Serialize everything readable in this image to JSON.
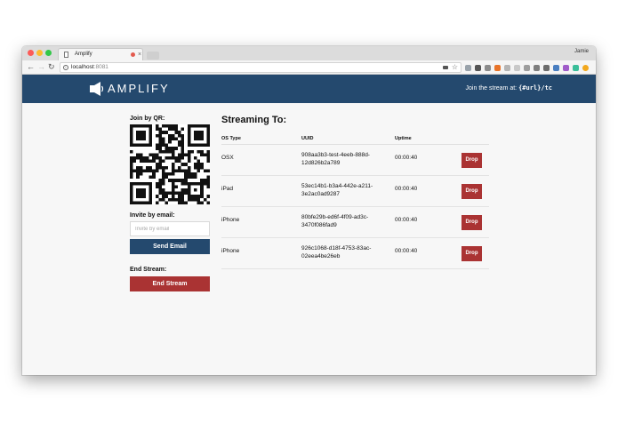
{
  "browser": {
    "tab_title": "Amplify",
    "user_name": "Jamie",
    "address_host": "localhost",
    "address_port": ":8081"
  },
  "header": {
    "logo_text": "AMPLIFY",
    "join_prefix": "Join the stream at: ",
    "join_url": "{#url}/tc"
  },
  "sidebar": {
    "qr_label": "Join by QR:",
    "email_label": "Invite by email:",
    "email_placeholder": "Invite by email",
    "send_button": "Send Email",
    "end_label": "End Stream:",
    "end_button": "End Stream"
  },
  "streams": {
    "title": "Streaming To:",
    "columns": [
      "OS Type",
      "UUID",
      "Uptime"
    ],
    "drop_label": "Drop",
    "rows": [
      {
        "os": "OSX",
        "uuid_line1": "908aa3b3-test-4eeb-888d-",
        "uuid_line2": "12d826b2a789",
        "uptime": "00:00:40"
      },
      {
        "os": "iPad",
        "uuid_line1": "53ec14b1-b3a4-442e-a211-",
        "uuid_line2": "3e2ac0ad9287",
        "uptime": "00:00:40"
      },
      {
        "os": "iPhone",
        "uuid_line1": "80bfe29b-ed6f-4f09-ad3c-",
        "uuid_line2": "3470f086fad9",
        "uptime": "00:00:40"
      },
      {
        "os": "iPhone",
        "uuid_line1": "926c1068-d18f-4753-83ac-",
        "uuid_line2": "02eea4be26eb",
        "uptime": "00:00:40"
      }
    ]
  },
  "colors": {
    "brand": "#24496e",
    "danger": "#aa3333"
  }
}
